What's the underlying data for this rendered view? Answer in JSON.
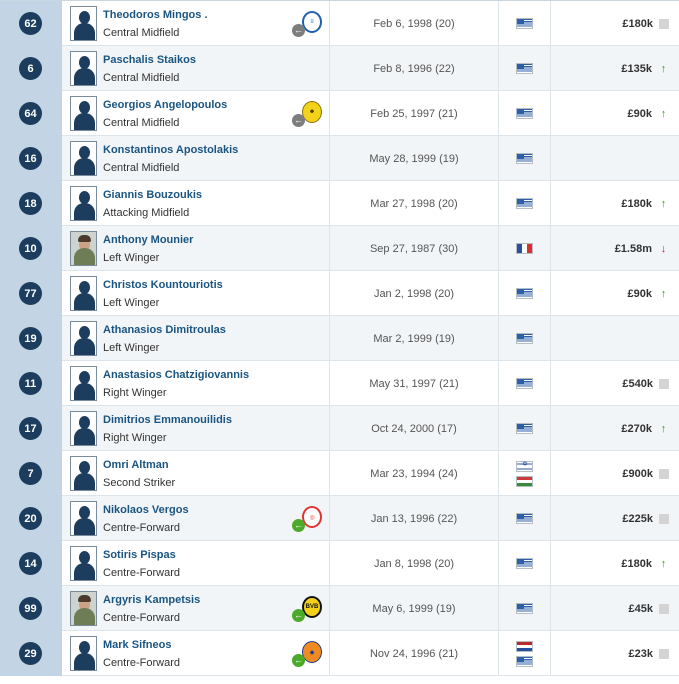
{
  "colors": {
    "number_badge": "#1c3d5e",
    "name_link": "#1a5582",
    "trend_up": "#3f9a2c",
    "trend_down": "#c92323"
  },
  "players": [
    {
      "number": "62",
      "name": "Theodoros Mingos .",
      "position": "Central Midfield",
      "dob": "Feb 6, 1998 (20)",
      "flags": [
        "greece"
      ],
      "value": "£180k",
      "trend": "none",
      "club": "club-crest-blue-white",
      "club_arrow": "grey",
      "photo": false
    },
    {
      "number": "6",
      "name": "Paschalis Staikos",
      "position": "Central Midfield",
      "dob": "Feb 8, 1996 (22)",
      "flags": [
        "greece"
      ],
      "value": "£135k",
      "trend": "up",
      "club": "",
      "club_arrow": "",
      "photo": false
    },
    {
      "number": "64",
      "name": "Georgios Angelopoulos",
      "position": "Central Midfield",
      "dob": "Feb 25, 1997 (21)",
      "flags": [
        "greece"
      ],
      "value": "£90k",
      "trend": "up",
      "club": "club-crest-yellow",
      "club_arrow": "grey",
      "photo": false
    },
    {
      "number": "16",
      "name": "Konstantinos Apostolakis",
      "position": "Central Midfield",
      "dob": "May 28, 1999 (19)",
      "flags": [
        "greece"
      ],
      "value": "",
      "trend": "blank",
      "club": "",
      "club_arrow": "",
      "photo": false
    },
    {
      "number": "18",
      "name": "Giannis Bouzoukis",
      "position": "Attacking Midfield",
      "dob": "Mar 27, 1998 (20)",
      "flags": [
        "greece"
      ],
      "value": "£180k",
      "trend": "up",
      "club": "",
      "club_arrow": "",
      "photo": false
    },
    {
      "number": "10",
      "name": "Anthony Mounier",
      "position": "Left Winger",
      "dob": "Sep 27, 1987 (30)",
      "flags": [
        "france"
      ],
      "value": "£1.58m",
      "trend": "down",
      "club": "",
      "club_arrow": "",
      "photo": true
    },
    {
      "number": "77",
      "name": "Christos Kountouriotis",
      "position": "Left Winger",
      "dob": "Jan 2, 1998 (20)",
      "flags": [
        "greece"
      ],
      "value": "£90k",
      "trend": "up",
      "club": "",
      "club_arrow": "",
      "photo": false
    },
    {
      "number": "19",
      "name": "Athanasios Dimitroulas",
      "position": "Left Winger",
      "dob": "Mar 2, 1999 (19)",
      "flags": [
        "greece"
      ],
      "value": "",
      "trend": "blank",
      "club": "",
      "club_arrow": "",
      "photo": false
    },
    {
      "number": "11",
      "name": "Anastasios Chatzigiovannis",
      "position": "Right Winger",
      "dob": "May 31, 1997 (21)",
      "flags": [
        "greece"
      ],
      "value": "£540k",
      "trend": "none",
      "club": "",
      "club_arrow": "",
      "photo": false
    },
    {
      "number": "17",
      "name": "Dimitrios Emmanouilidis",
      "position": "Right Winger",
      "dob": "Oct 24, 2000 (17)",
      "flags": [
        "greece"
      ],
      "value": "£270k",
      "trend": "up",
      "club": "",
      "club_arrow": "",
      "photo": false
    },
    {
      "number": "7",
      "name": "Omri Altman",
      "position": "Second Striker",
      "dob": "Mar 23, 1994 (24)",
      "flags": [
        "israel",
        "hungary"
      ],
      "value": "£900k",
      "trend": "none",
      "club": "",
      "club_arrow": "",
      "photo": false
    },
    {
      "number": "20",
      "name": "Nikolaos Vergos",
      "position": "Centre-Forward",
      "dob": "Jan 13, 1996 (22)",
      "flags": [
        "greece"
      ],
      "value": "£225k",
      "trend": "none",
      "club": "club-crest-red-white",
      "club_arrow": "green",
      "photo": false
    },
    {
      "number": "14",
      "name": "Sotiris Pispas",
      "position": "Centre-Forward",
      "dob": "Jan 8, 1998 (20)",
      "flags": [
        "greece"
      ],
      "value": "£180k",
      "trend": "up",
      "club": "",
      "club_arrow": "",
      "photo": false
    },
    {
      "number": "99",
      "name": "Argyris Kampetsis",
      "position": "Centre-Forward",
      "dob": "May 6, 1999 (19)",
      "flags": [
        "greece"
      ],
      "value": "£45k",
      "trend": "none",
      "club": "club-crest-bvb",
      "club_arrow": "green",
      "photo": true
    },
    {
      "number": "29",
      "name": "Mark Sifneos",
      "position": "Centre-Forward",
      "dob": "Nov 24, 1996 (21)",
      "flags": [
        "netherlands",
        "greece"
      ],
      "value": "£23k",
      "trend": "none",
      "club": "club-crest-orange-blue",
      "club_arrow": "green",
      "photo": false
    }
  ]
}
